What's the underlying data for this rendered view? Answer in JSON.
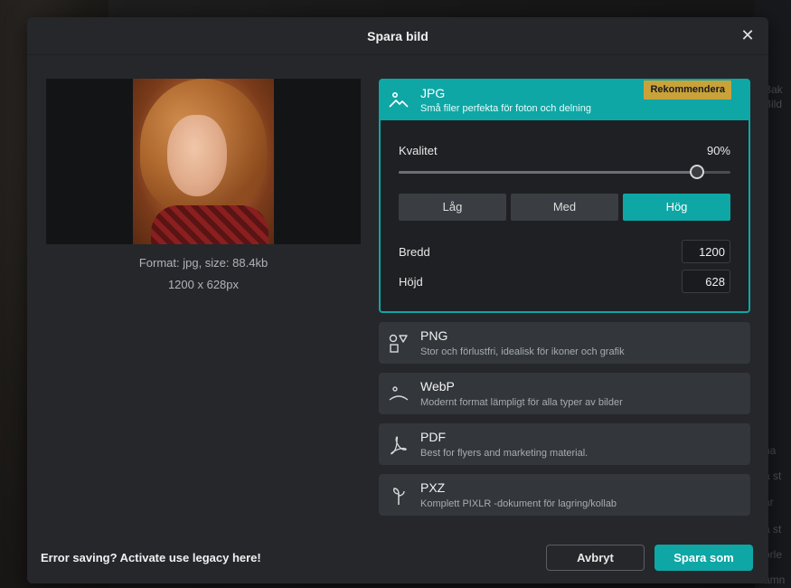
{
  "background": {
    "side_texts": [
      "Bak",
      "Bild",
      "na",
      "a st",
      "är",
      "a st",
      "orle",
      "amn"
    ]
  },
  "dialog": {
    "title": "Spara bild",
    "close_icon": "close-icon"
  },
  "preview": {
    "format_line": "Format: jpg, size: 88.4kb",
    "size_line": "1200 x 628px"
  },
  "jpg": {
    "name": "JPG",
    "desc": "Små filer perfekta för foton och delning",
    "badge": "Rekommendera",
    "quality_label": "Kvalitet",
    "quality_value": "90%",
    "quality_fraction": 0.9,
    "quality_buttons": [
      "Låg",
      "Med",
      "Hög"
    ],
    "active_quality": "Hög",
    "width_label": "Bredd",
    "width_value": "1200",
    "height_label": "Höjd",
    "height_value": "628"
  },
  "formats": [
    {
      "name": "PNG",
      "desc": "Stor och förlustfri, idealisk för ikoner och grafik",
      "icon": "shapes-icon"
    },
    {
      "name": "WebP",
      "desc": "Modernt format lämpligt för alla typer av bilder",
      "icon": "webp-icon"
    },
    {
      "name": "PDF",
      "desc": "Best for flyers and marketing material.",
      "icon": "pdf-icon"
    },
    {
      "name": "PXZ",
      "desc": "Komplett PIXLR -dokument för lagring/kollab",
      "icon": "pxz-icon"
    }
  ],
  "footer": {
    "legacy_link": "Error saving? Activate use legacy here!",
    "cancel": "Avbryt",
    "save": "Spara som"
  },
  "colors": {
    "accent": "#0ea7a5",
    "badge": "#c9a23a",
    "dialog_bg": "#25272b"
  }
}
